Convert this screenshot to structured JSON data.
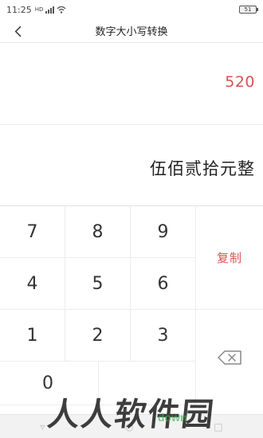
{
  "status": {
    "time": "11:25",
    "network": "HD",
    "battery": "51"
  },
  "header": {
    "title": "数字大小写转换",
    "back_icon": "back-arrow-icon"
  },
  "display": {
    "number": "520",
    "chinese": "伍佰贰拾元整"
  },
  "keypad": {
    "keys": [
      "7",
      "8",
      "9",
      "4",
      "5",
      "6",
      "1",
      "2",
      "3",
      "0"
    ],
    "copy_label": "复制",
    "backspace_icon": "backspace-icon",
    "accent_color": "#d9534f"
  },
  "watermark": {
    "text": "人人软件园",
    "sub": "down"
  }
}
